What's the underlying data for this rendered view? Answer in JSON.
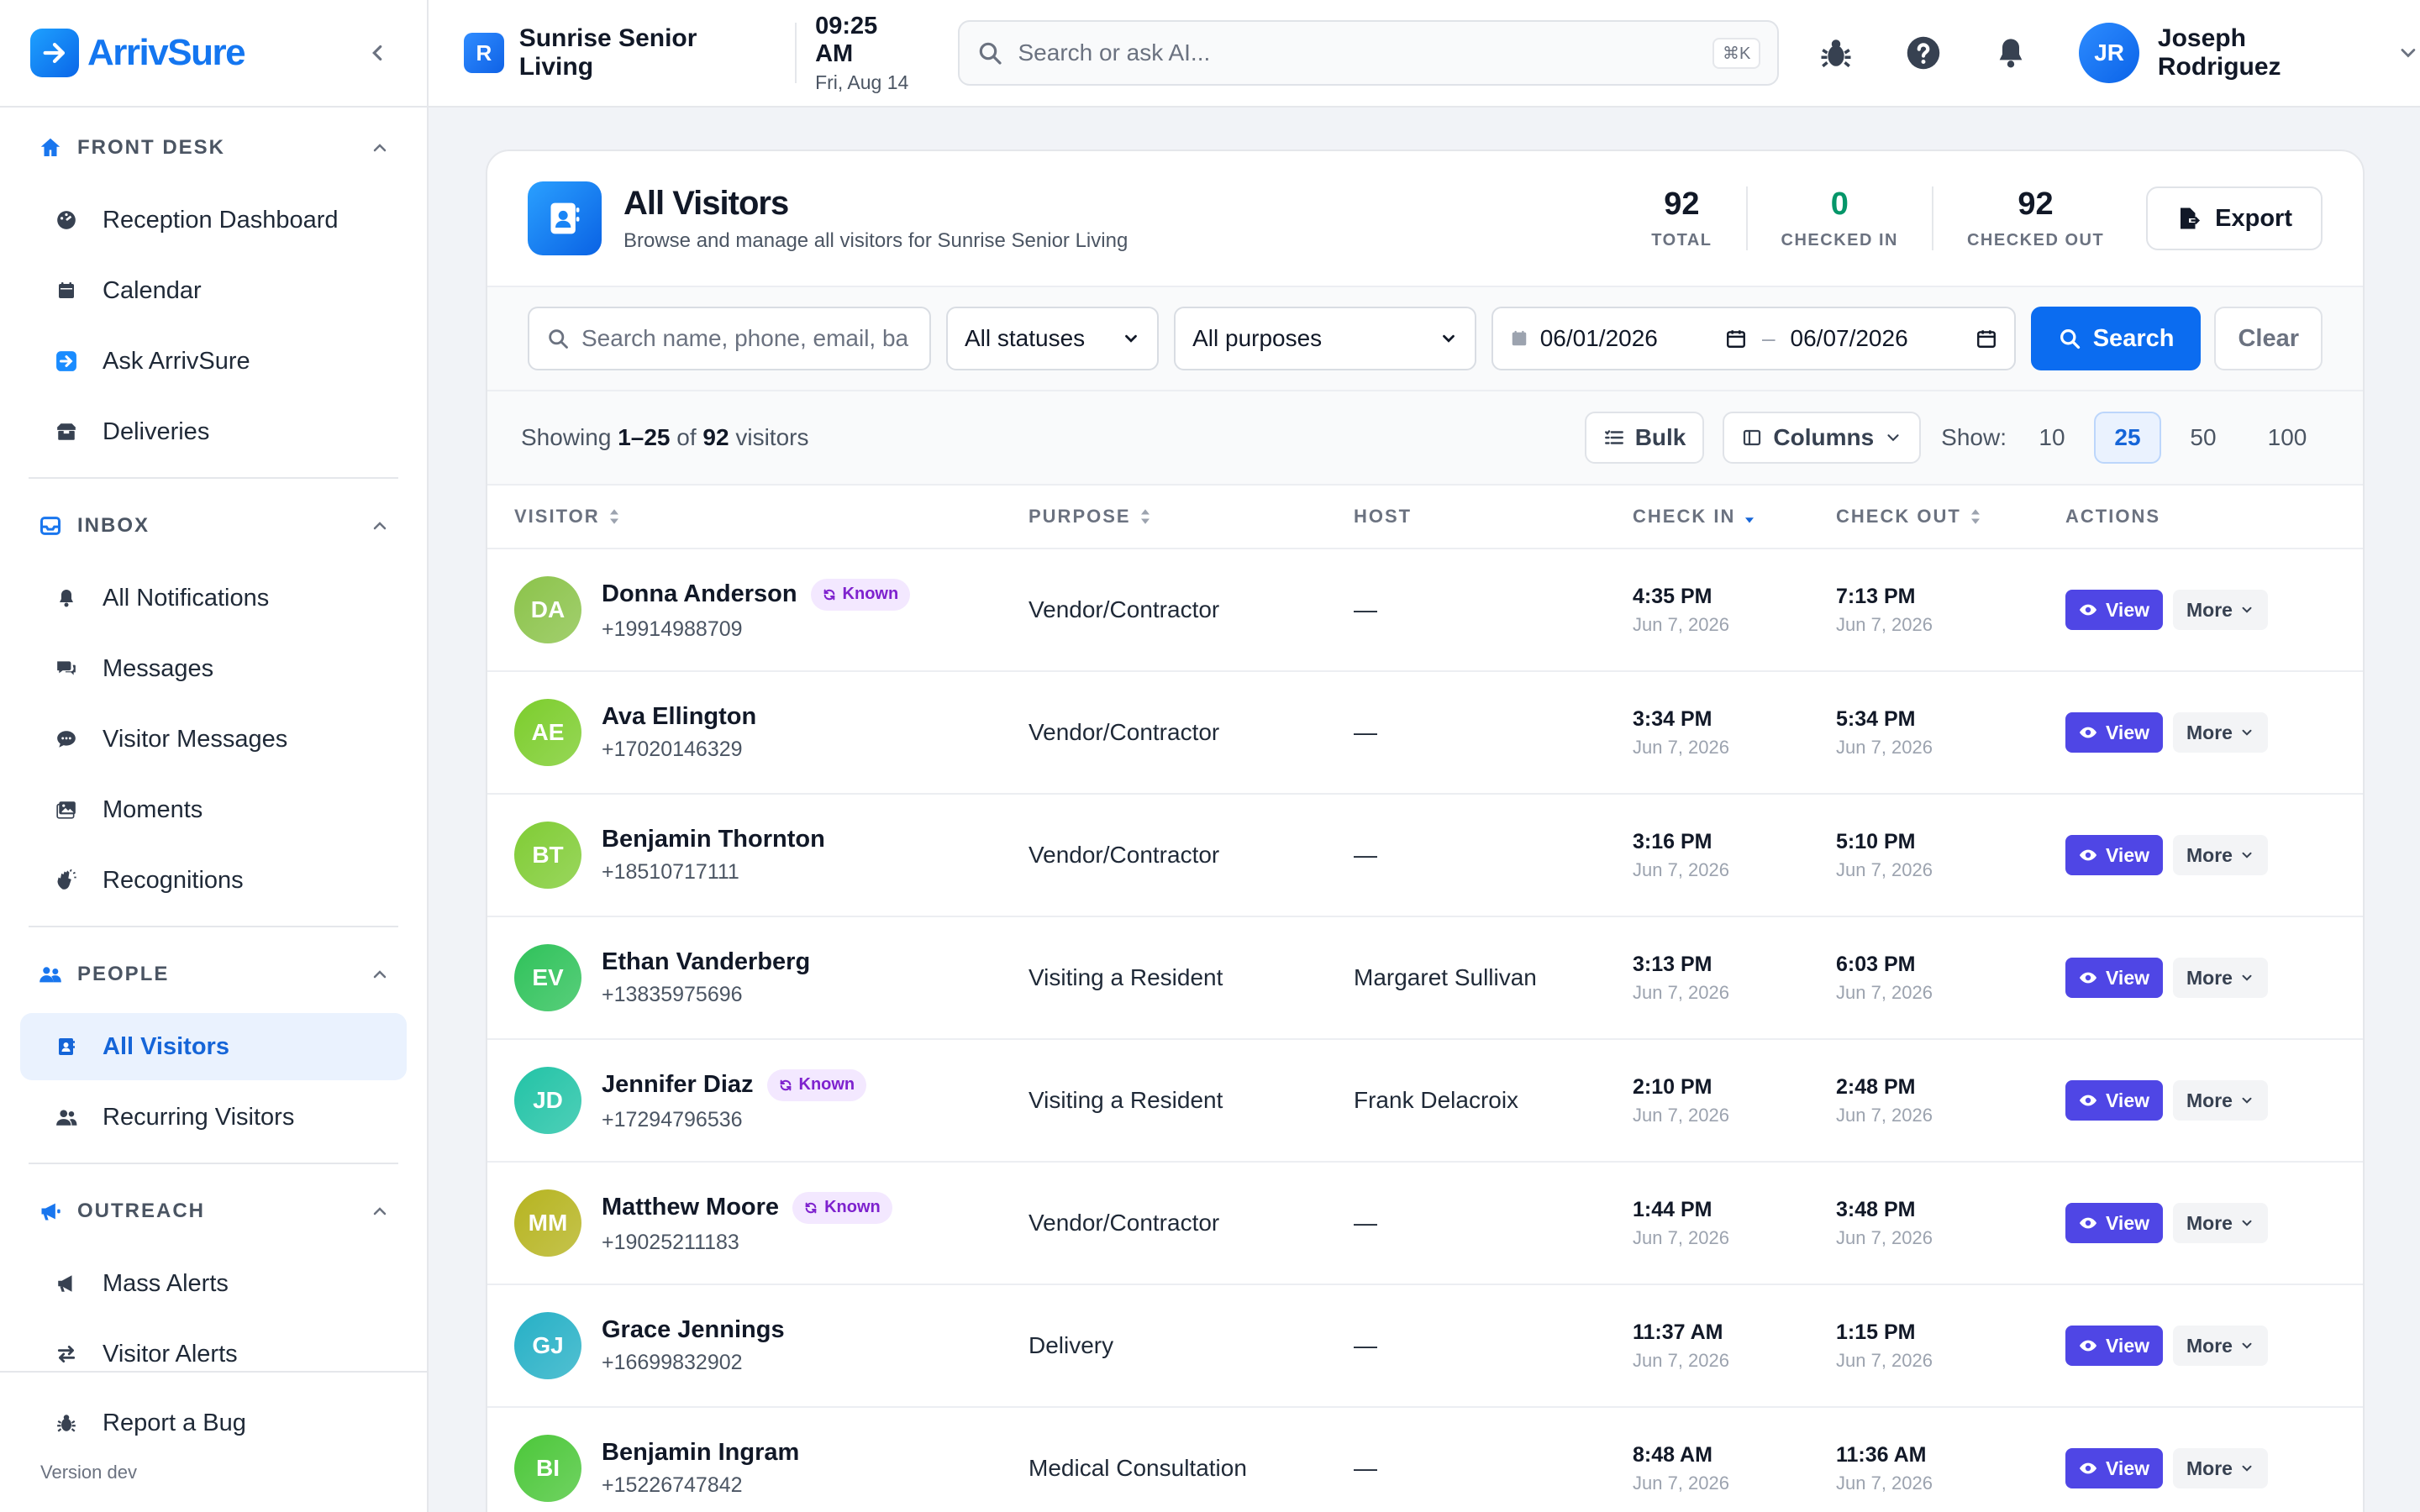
{
  "brand": {
    "name": "ArrivSure"
  },
  "sidebar": {
    "sections": [
      {
        "title": "FRONT DESK",
        "items": [
          {
            "label": "Reception Dashboard"
          },
          {
            "label": "Calendar"
          },
          {
            "label": "Ask ArrivSure"
          },
          {
            "label": "Deliveries"
          }
        ]
      },
      {
        "title": "INBOX",
        "items": [
          {
            "label": "All Notifications"
          },
          {
            "label": "Messages"
          },
          {
            "label": "Visitor Messages"
          },
          {
            "label": "Moments"
          },
          {
            "label": "Recognitions"
          }
        ]
      },
      {
        "title": "PEOPLE",
        "items": [
          {
            "label": "All Visitors"
          },
          {
            "label": "Recurring Visitors"
          }
        ]
      },
      {
        "title": "OUTREACH",
        "items": [
          {
            "label": "Mass Alerts"
          },
          {
            "label": "Visitor Alerts"
          }
        ]
      }
    ],
    "footer": {
      "report_bug": "Report a Bug",
      "version": "Version dev"
    }
  },
  "topbar": {
    "org_initial": "R",
    "org_name": "Sunrise Senior Living",
    "time": "09:25 AM",
    "date": "Fri, Aug 14",
    "search_placeholder": "Search or ask AI...",
    "shortcut": "⌘K",
    "user_initials": "JR",
    "user_name": "Joseph Rodriguez"
  },
  "page": {
    "title": "All Visitors",
    "subtitle": "Browse and manage all visitors for Sunrise Senior Living",
    "stats": [
      {
        "value": "92",
        "label": "TOTAL",
        "color": "#111827"
      },
      {
        "value": "0",
        "label": "CHECKED IN",
        "color": "#059669"
      },
      {
        "value": "92",
        "label": "CHECKED OUT",
        "color": "#111827"
      }
    ],
    "export_label": "Export"
  },
  "filters": {
    "search_placeholder": "Search name, phone, email, ba",
    "status_value": "All statuses",
    "purpose_value": "All purposes",
    "date_from": "06/01/2026",
    "date_sep": "–",
    "date_to": "06/07/2026",
    "search_label": "Search",
    "clear_label": "Clear"
  },
  "toolbar": {
    "showing_prefix": "Showing ",
    "showing_range": "1–25",
    "showing_of": " of ",
    "showing_total": "92",
    "showing_suffix": " visitors",
    "bulk_label": "Bulk",
    "columns_label": "Columns",
    "show_label": "Show:",
    "page_sizes": [
      "10",
      "25",
      "50",
      "100"
    ]
  },
  "table": {
    "headers": [
      "VISITOR",
      "PURPOSE",
      "HOST",
      "CHECK IN",
      "CHECK OUT",
      "ACTIONS"
    ],
    "view_label": "View",
    "more_label": "More",
    "known_label": "Known",
    "rows": [
      {
        "initials": "DA",
        "name": "Donna Anderson",
        "phone": "+19914988709",
        "known": true,
        "purpose": "Vendor/Contractor",
        "host": "—",
        "in_time": "4:35 PM",
        "in_date": "Jun 7, 2026",
        "out_time": "7:13 PM",
        "out_date": "Jun 7, 2026",
        "color": "#8bc34a"
      },
      {
        "initials": "AE",
        "name": "Ava Ellington",
        "phone": "+17020146329",
        "known": false,
        "purpose": "Vendor/Contractor",
        "host": "—",
        "in_time": "3:34 PM",
        "in_date": "Jun 7, 2026",
        "out_time": "5:34 PM",
        "out_date": "Jun 7, 2026",
        "color": "#7ccd2c"
      },
      {
        "initials": "BT",
        "name": "Benjamin Thornton",
        "phone": "+18510717111",
        "known": false,
        "purpose": "Vendor/Contractor",
        "host": "—",
        "in_time": "3:16 PM",
        "in_date": "Jun 7, 2026",
        "out_time": "5:10 PM",
        "out_date": "Jun 7, 2026",
        "color": "#80cc35"
      },
      {
        "initials": "EV",
        "name": "Ethan Vanderberg",
        "phone": "+13835975696",
        "known": false,
        "purpose": "Visiting a Resident",
        "host": "Margaret Sullivan",
        "in_time": "3:13 PM",
        "in_date": "Jun 7, 2026",
        "out_time": "6:03 PM",
        "out_date": "Jun 7, 2026",
        "color": "#2fc25a"
      },
      {
        "initials": "JD",
        "name": "Jennifer Diaz",
        "phone": "+17294796536",
        "known": true,
        "purpose": "Visiting a Resident",
        "host": "Frank Delacroix",
        "in_time": "2:10 PM",
        "in_date": "Jun 7, 2026",
        "out_time": "2:48 PM",
        "out_date": "Jun 7, 2026",
        "color": "#22c3a6"
      },
      {
        "initials": "MM",
        "name": "Matthew Moore",
        "phone": "+19025211183",
        "known": true,
        "purpose": "Vendor/Contractor",
        "host": "—",
        "in_time": "1:44 PM",
        "in_date": "Jun 7, 2026",
        "out_time": "3:48 PM",
        "out_date": "Jun 7, 2026",
        "color": "#b6b420"
      },
      {
        "initials": "GJ",
        "name": "Grace Jennings",
        "phone": "+16699832902",
        "known": false,
        "purpose": "Delivery",
        "host": "—",
        "in_time": "11:37 AM",
        "in_date": "Jun 7, 2026",
        "out_time": "1:15 PM",
        "out_date": "Jun 7, 2026",
        "color": "#26b0c6"
      },
      {
        "initials": "BI",
        "name": "Benjamin Ingram",
        "phone": "+15226747842",
        "known": false,
        "purpose": "Medical Consultation",
        "host": "—",
        "in_time": "8:48 AM",
        "in_date": "Jun 7, 2026",
        "out_time": "11:36 AM",
        "out_date": "Jun 7, 2026",
        "color": "#4cc73a"
      }
    ]
  },
  "colors": {
    "accent": "#0b6cf0",
    "view_button": "#4f46e5",
    "known_badge": "#7e22ce"
  }
}
